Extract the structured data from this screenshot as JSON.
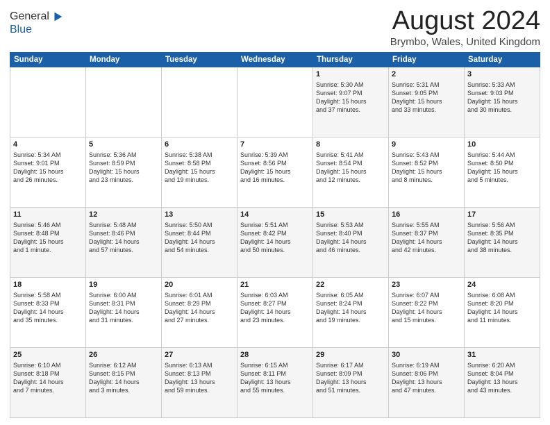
{
  "logo": {
    "general": "General",
    "blue": "Blue"
  },
  "header": {
    "month": "August 2024",
    "location": "Brymbo, Wales, United Kingdom"
  },
  "weekdays": [
    "Sunday",
    "Monday",
    "Tuesday",
    "Wednesday",
    "Thursday",
    "Friday",
    "Saturday"
  ],
  "weeks": [
    [
      {
        "day": "",
        "info": ""
      },
      {
        "day": "",
        "info": ""
      },
      {
        "day": "",
        "info": ""
      },
      {
        "day": "",
        "info": ""
      },
      {
        "day": "1",
        "info": "Sunrise: 5:30 AM\nSunset: 9:07 PM\nDaylight: 15 hours\nand 37 minutes."
      },
      {
        "day": "2",
        "info": "Sunrise: 5:31 AM\nSunset: 9:05 PM\nDaylight: 15 hours\nand 33 minutes."
      },
      {
        "day": "3",
        "info": "Sunrise: 5:33 AM\nSunset: 9:03 PM\nDaylight: 15 hours\nand 30 minutes."
      }
    ],
    [
      {
        "day": "4",
        "info": "Sunrise: 5:34 AM\nSunset: 9:01 PM\nDaylight: 15 hours\nand 26 minutes."
      },
      {
        "day": "5",
        "info": "Sunrise: 5:36 AM\nSunset: 8:59 PM\nDaylight: 15 hours\nand 23 minutes."
      },
      {
        "day": "6",
        "info": "Sunrise: 5:38 AM\nSunset: 8:58 PM\nDaylight: 15 hours\nand 19 minutes."
      },
      {
        "day": "7",
        "info": "Sunrise: 5:39 AM\nSunset: 8:56 PM\nDaylight: 15 hours\nand 16 minutes."
      },
      {
        "day": "8",
        "info": "Sunrise: 5:41 AM\nSunset: 8:54 PM\nDaylight: 15 hours\nand 12 minutes."
      },
      {
        "day": "9",
        "info": "Sunrise: 5:43 AM\nSunset: 8:52 PM\nDaylight: 15 hours\nand 8 minutes."
      },
      {
        "day": "10",
        "info": "Sunrise: 5:44 AM\nSunset: 8:50 PM\nDaylight: 15 hours\nand 5 minutes."
      }
    ],
    [
      {
        "day": "11",
        "info": "Sunrise: 5:46 AM\nSunset: 8:48 PM\nDaylight: 15 hours\nand 1 minute."
      },
      {
        "day": "12",
        "info": "Sunrise: 5:48 AM\nSunset: 8:46 PM\nDaylight: 14 hours\nand 57 minutes."
      },
      {
        "day": "13",
        "info": "Sunrise: 5:50 AM\nSunset: 8:44 PM\nDaylight: 14 hours\nand 54 minutes."
      },
      {
        "day": "14",
        "info": "Sunrise: 5:51 AM\nSunset: 8:42 PM\nDaylight: 14 hours\nand 50 minutes."
      },
      {
        "day": "15",
        "info": "Sunrise: 5:53 AM\nSunset: 8:40 PM\nDaylight: 14 hours\nand 46 minutes."
      },
      {
        "day": "16",
        "info": "Sunrise: 5:55 AM\nSunset: 8:37 PM\nDaylight: 14 hours\nand 42 minutes."
      },
      {
        "day": "17",
        "info": "Sunrise: 5:56 AM\nSunset: 8:35 PM\nDaylight: 14 hours\nand 38 minutes."
      }
    ],
    [
      {
        "day": "18",
        "info": "Sunrise: 5:58 AM\nSunset: 8:33 PM\nDaylight: 14 hours\nand 35 minutes."
      },
      {
        "day": "19",
        "info": "Sunrise: 6:00 AM\nSunset: 8:31 PM\nDaylight: 14 hours\nand 31 minutes."
      },
      {
        "day": "20",
        "info": "Sunrise: 6:01 AM\nSunset: 8:29 PM\nDaylight: 14 hours\nand 27 minutes."
      },
      {
        "day": "21",
        "info": "Sunrise: 6:03 AM\nSunset: 8:27 PM\nDaylight: 14 hours\nand 23 minutes."
      },
      {
        "day": "22",
        "info": "Sunrise: 6:05 AM\nSunset: 8:24 PM\nDaylight: 14 hours\nand 19 minutes."
      },
      {
        "day": "23",
        "info": "Sunrise: 6:07 AM\nSunset: 8:22 PM\nDaylight: 14 hours\nand 15 minutes."
      },
      {
        "day": "24",
        "info": "Sunrise: 6:08 AM\nSunset: 8:20 PM\nDaylight: 14 hours\nand 11 minutes."
      }
    ],
    [
      {
        "day": "25",
        "info": "Sunrise: 6:10 AM\nSunset: 8:18 PM\nDaylight: 14 hours\nand 7 minutes."
      },
      {
        "day": "26",
        "info": "Sunrise: 6:12 AM\nSunset: 8:15 PM\nDaylight: 14 hours\nand 3 minutes."
      },
      {
        "day": "27",
        "info": "Sunrise: 6:13 AM\nSunset: 8:13 PM\nDaylight: 13 hours\nand 59 minutes."
      },
      {
        "day": "28",
        "info": "Sunrise: 6:15 AM\nSunset: 8:11 PM\nDaylight: 13 hours\nand 55 minutes."
      },
      {
        "day": "29",
        "info": "Sunrise: 6:17 AM\nSunset: 8:09 PM\nDaylight: 13 hours\nand 51 minutes."
      },
      {
        "day": "30",
        "info": "Sunrise: 6:19 AM\nSunset: 8:06 PM\nDaylight: 13 hours\nand 47 minutes."
      },
      {
        "day": "31",
        "info": "Sunrise: 6:20 AM\nSunset: 8:04 PM\nDaylight: 13 hours\nand 43 minutes."
      }
    ]
  ]
}
